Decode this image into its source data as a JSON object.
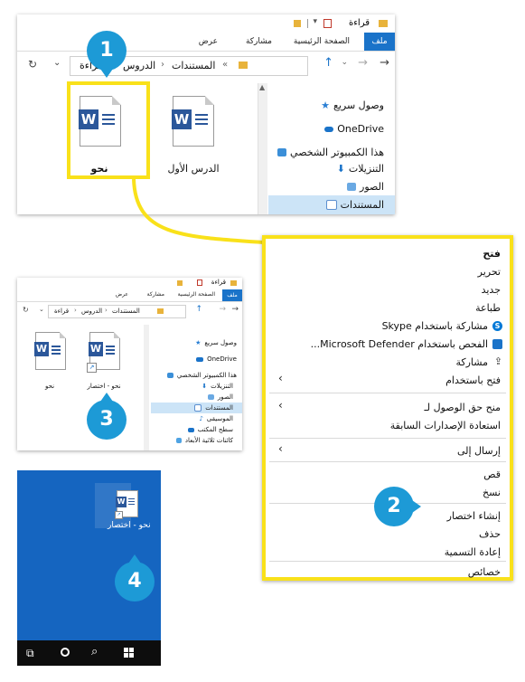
{
  "explorer_top": {
    "tabs": [
      "ملف",
      "الصفحة الرئيسية",
      "مشاركة",
      "عرض"
    ],
    "title": "قراءة",
    "breadcrumb": [
      "المستندات",
      "الدروس",
      "قراءة"
    ],
    "nav": [
      "وصول سريع",
      "OneDrive",
      "هذا الكمبيوتر الشخصي",
      "التنزيلات",
      "الصور",
      "المستندات"
    ],
    "files": [
      "الدرس الأول",
      "نحو"
    ]
  },
  "explorer_small": {
    "tabs": [
      "ملف",
      "الصفحة الرئيسية",
      "مشاركة",
      "عرض"
    ],
    "title": "قراءة",
    "breadcrumb": [
      "المستندات",
      "الدروس",
      "قراءة"
    ],
    "nav": [
      "وصول سريع",
      "OneDrive",
      "هذا الكمبيوتر الشخصي",
      "التنزيلات",
      "الصور",
      "المستندات",
      "الموسيقى",
      "سطح المكتب",
      "كائنات ثلاثية الأبعاد"
    ],
    "files": [
      "نحو - اختصار",
      "نحو"
    ]
  },
  "context_menu": {
    "items": [
      {
        "label": "فتح",
        "bold": true
      },
      {
        "label": "تحرير"
      },
      {
        "label": "جديد"
      },
      {
        "label": "طباعة"
      },
      {
        "label": "مشاركة باستخدام Skype",
        "icon": "skype-icon",
        "color": "#0078d7"
      },
      {
        "label": "الفحص باستخدام Microsoft Defender...",
        "icon": "defender-icon",
        "color": "#1a73c9"
      },
      {
        "label": "مشاركة",
        "icon": "share-icon"
      },
      {
        "label": "فتح باستخدام",
        "submenu": true
      },
      {
        "label": "منح حق الوصول لـ",
        "submenu": true
      },
      {
        "label": "استعادة الإصدارات السابقة"
      },
      {
        "label": "إرسال إلى",
        "submenu": true
      },
      {
        "label": "قص"
      },
      {
        "label": "نسخ"
      },
      {
        "label": "إنشاء اختصار"
      },
      {
        "label": "حذف"
      },
      {
        "label": "إعادة التسمية"
      },
      {
        "label": "خصائص"
      }
    ]
  },
  "desktop": {
    "shortcut_label": "نحو - اختصار",
    "taskbar_icons": [
      "windows-icon",
      "search-icon",
      "cortana-icon",
      "task-view-icon"
    ]
  },
  "badges": [
    "1",
    "2",
    "3",
    "4"
  ],
  "colors": {
    "highlight": "#f9e11a",
    "badge": "#1d9ad6",
    "word_blue": "#2b579a",
    "ribbon_file": "#1a73c9",
    "desktop": "#1565c0"
  }
}
